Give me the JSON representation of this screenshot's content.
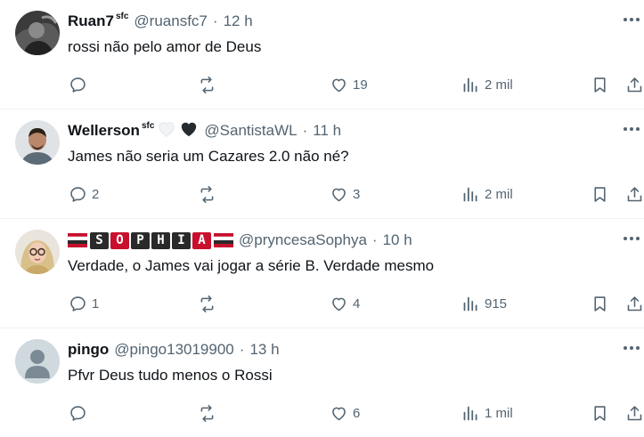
{
  "tweets": [
    {
      "name": "Ruan7",
      "name_suffix": "sfc",
      "handle": "@ruansfc7",
      "time": "12 h",
      "text": "rossi não pelo amor de Deus",
      "replies": "",
      "retweets": "",
      "likes": "19",
      "views": "2 mil",
      "avatar": "photo-dark"
    },
    {
      "name": "Wellerson",
      "name_suffix": "sfc",
      "handle": "@SantistaWL",
      "time": "11 h",
      "text": "James não seria um Cazares 2.0 não né?",
      "replies": "2",
      "retweets": "",
      "likes": "3",
      "views": "2 mil",
      "avatar": "photo-person"
    },
    {
      "name": "SOPHIA",
      "name_suffix": "",
      "handle": "@pryncesaSophya",
      "time": "10 h",
      "text": "Verdade, o James vai jogar a série B. Verdade mesmo",
      "replies": "1",
      "retweets": "",
      "likes": "4",
      "views": "915",
      "avatar": "photo-woman"
    },
    {
      "name": "pingo",
      "name_suffix": "",
      "handle": "@pingo13019900",
      "time": "13 h",
      "text": "Pfvr Deus tudo menos o Rossi",
      "replies": "",
      "retweets": "",
      "likes": "6",
      "views": "1 mil",
      "avatar": "default-silhouette"
    }
  ],
  "separator": "·",
  "icons": [
    "reply-icon",
    "retweet-icon",
    "like-icon",
    "views-icon",
    "bookmark-icon",
    "share-icon",
    "more-icon"
  ],
  "colors": {
    "text": "#0f1419",
    "muted": "#536471",
    "divider": "#eff3f4",
    "flag_red": "#c8102e",
    "flag_dark": "#2a2a2a"
  }
}
